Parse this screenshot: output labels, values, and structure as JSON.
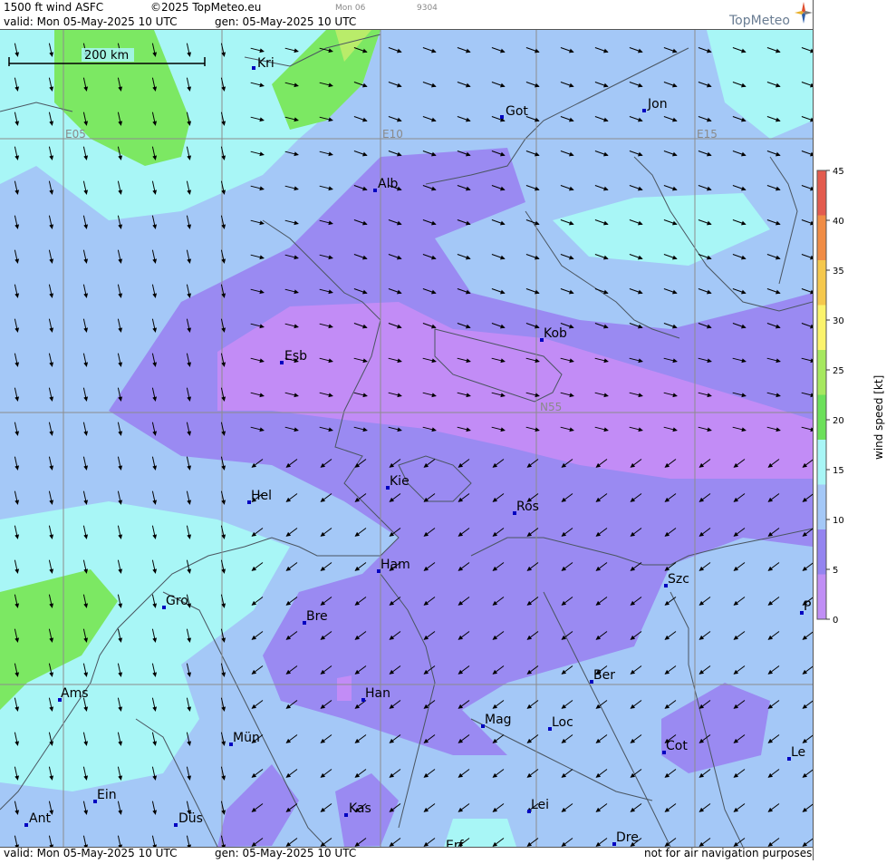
{
  "header": {
    "product": "1500 ft wind ASFC",
    "copyright": "©2025 TopMeteo.eu",
    "faint_day": "Mon 06",
    "faint_code": "9304",
    "valid": "valid:  Mon  05-May-2025  10 UTC",
    "gen": "gen: 05-May-2025 10 UTC",
    "logo": "TopMeteo"
  },
  "footer": {
    "valid": "valid:  Mon  05-May-2025  10 UTC",
    "gen": "gen: 05-May-2025 10 UTC",
    "disclaimer": "not for air navigation purposes"
  },
  "scale_bar": "200 km",
  "grid_labels": {
    "e05": "E05",
    "e10": "E10",
    "e15": "E15",
    "n55": "N55"
  },
  "cities": {
    "kri": "Kri",
    "got": "Got",
    "jon": "Jon",
    "alb": "Alb",
    "esb": "Esb",
    "kob": "Kob",
    "kie": "Kie",
    "hel": "Hel",
    "ros": "Ros",
    "ham": "Ham",
    "szc": "Szc",
    "gro": "Gro",
    "bre": "Bre",
    "p": "P",
    "ams": "Ams",
    "han": "Han",
    "ber": "Ber",
    "mag": "Mag",
    "loc": "Loc",
    "mun": "Mün",
    "cot": "Cot",
    "lei": "Lei",
    "ein": "Ein",
    "kas": "Kas",
    "ant": "Ant",
    "dus": "Düs",
    "dre": "Dre",
    "erf": "Erf",
    "le": "Le"
  },
  "legend": {
    "title": "wind speed [kt]",
    "ticks": [
      "45",
      "40",
      "35",
      "30",
      "25",
      "20",
      "15",
      "10",
      "5",
      "0"
    ],
    "colors": [
      "#e35b4e",
      "#f08c45",
      "#f5c84c",
      "#fbf36c",
      "#a6e85f",
      "#6ce05a",
      "#a8f6f6",
      "#a4c8f7",
      "#9484f0",
      "#c08ef5"
    ]
  }
}
